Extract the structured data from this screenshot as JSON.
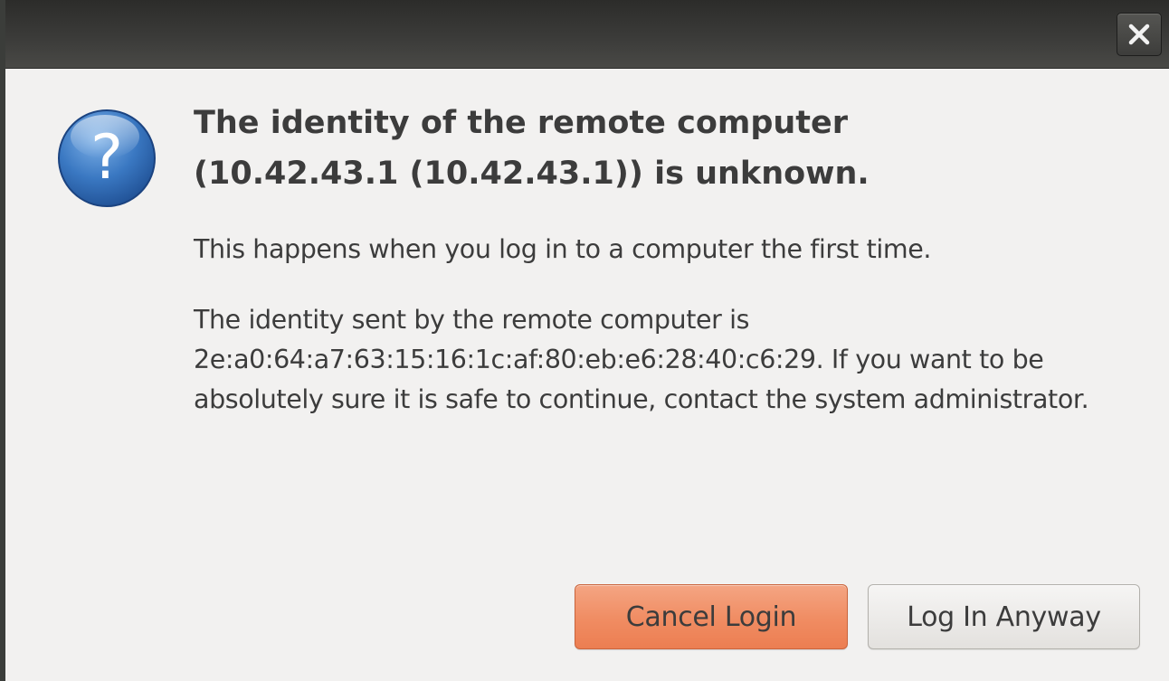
{
  "dialog": {
    "icon": "question-icon",
    "heading": "The identity of the remote computer (10.42.43.1 (10.42.43.1)) is unknown.",
    "paragraph1": "This happens when you log in to a computer the first time.",
    "paragraph2": "The identity sent by the remote computer is 2e:a0:64:a7:63:15:16:1c:af:80:eb:e6:28:40:c6:29. If you want to be absolutely sure it is safe to continue, contact the system administrator."
  },
  "titlebar": {
    "close_icon": "close-icon"
  },
  "buttons": {
    "cancel_label": "Cancel Login",
    "login_label": "Log In Anyway"
  },
  "colors": {
    "accent": "#f08c62",
    "titlebar": "#3b3b39",
    "background": "#f2f1f0",
    "icon_blue": "#2f6fb8"
  }
}
